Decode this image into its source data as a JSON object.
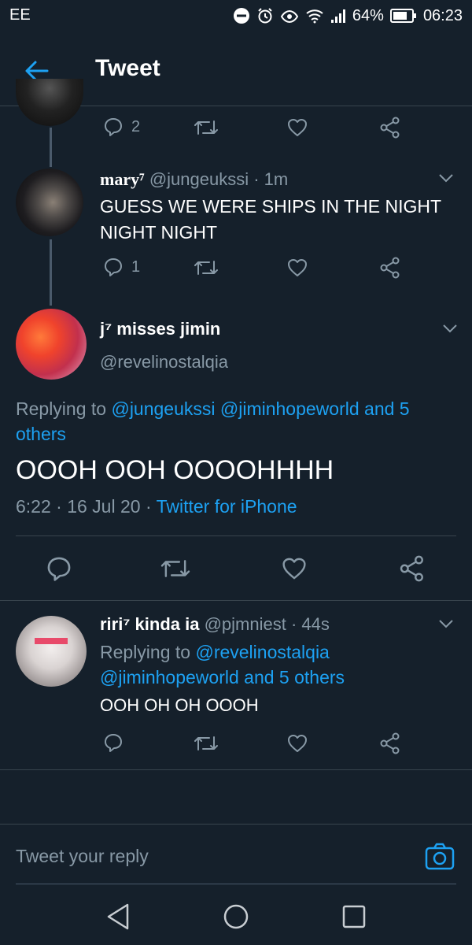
{
  "status": {
    "carrier": "EE",
    "battery": "64%",
    "time": "06:23"
  },
  "header": {
    "title": "Tweet"
  },
  "prev_tweet": {
    "replies": "2"
  },
  "tweet1": {
    "name": "mary⁷",
    "handle": "@jungeukssi",
    "time": "· 1m",
    "text_line1": "GUESS WE WERE SHIPS IN THE NIGHT",
    "text_line2": "NIGHT NIGHT",
    "replies": "1"
  },
  "main_tweet": {
    "name": "j⁷ misses jimin",
    "handle": "@revelinostalqia",
    "replying_prefix": "Replying to ",
    "replying_users": "@jungeukssi @jiminhopeworld and 5",
    "replying_users_2": "others",
    "text": "OOOH OOH OOOOHHHH",
    "meta_time": "6:22 · 16 Jul 20 · ",
    "meta_source": "Twitter for iPhone"
  },
  "reply_tweet": {
    "name": "riri⁷ kinda ia",
    "handle": "@pjmniest",
    "time": "· 44s",
    "replying_prefix": "Replying to ",
    "replying_user1": "@revelinostalqia",
    "replying_line2": "@jiminhopeworld and 5 others",
    "text": "OOH OH OH OOOH"
  },
  "compose": {
    "placeholder": "Tweet your reply"
  },
  "colors": {
    "background": "#15202b",
    "accent": "#1da1f2",
    "muted": "#8899a6",
    "divider": "#38444d"
  },
  "icons": [
    "back-arrow-icon",
    "reply-icon",
    "retweet-icon",
    "like-icon",
    "share-icon",
    "chevron-down-icon",
    "camera-icon",
    "nav-back-icon",
    "nav-home-icon",
    "nav-recents-icon"
  ]
}
